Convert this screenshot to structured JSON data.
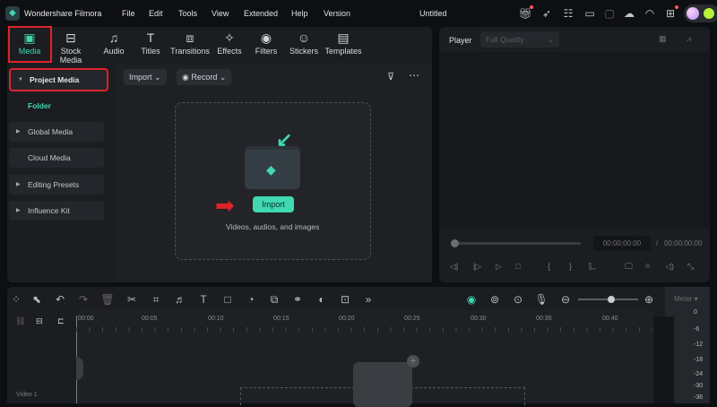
{
  "app": {
    "name": "Wondershare Filmora",
    "project_title": "Untitled"
  },
  "menu": [
    "File",
    "Edit",
    "Tools",
    "View",
    "Extended",
    "Help",
    "Version"
  ],
  "toolbar": [
    {
      "label": "Media",
      "icon": "media-icon",
      "glyph": "▣"
    },
    {
      "label": "Stock Media",
      "icon": "stock-media-icon",
      "glyph": "⊟"
    },
    {
      "label": "Audio",
      "icon": "music-note-icon",
      "glyph": "♫"
    },
    {
      "label": "Titles",
      "icon": "text-t-icon",
      "glyph": "T"
    },
    {
      "label": "Transitions",
      "icon": "transitions-icon",
      "glyph": "⧈"
    },
    {
      "label": "Effects",
      "icon": "effects-star-icon",
      "glyph": "✧"
    },
    {
      "label": "Filters",
      "icon": "filters-icon",
      "glyph": "◉"
    },
    {
      "label": "Stickers",
      "icon": "sticker-icon",
      "glyph": "☺"
    },
    {
      "label": "Templates",
      "icon": "templates-icon",
      "glyph": "▤"
    }
  ],
  "sidebar": {
    "project_media": "Project Media",
    "folder": "Folder",
    "items": [
      "Global Media",
      "Cloud Media",
      "Editing Presets",
      "Influence Kit"
    ]
  },
  "media": {
    "import_dropdown": "Import",
    "record_dropdown": "Record",
    "import_button": "Import",
    "hint": "Videos, audios, and images"
  },
  "player": {
    "label": "Player",
    "quality": "Full Quality",
    "current_time": "00:00:00:00",
    "separator": "/",
    "total_time": "00:00:00:00",
    "progress": 0
  },
  "timeline": {
    "ruler": [
      "00:00",
      "00:05",
      "00:10",
      "00:15",
      "00:20",
      "00:25",
      "00:30",
      "00:35",
      "00:40"
    ],
    "track_label": "Video 1",
    "meter_label": "Meter",
    "meter_scale": [
      "0",
      "-6",
      "-12",
      "-18",
      "-24",
      "-30",
      "-36"
    ],
    "zoom_level": 0.75
  },
  "colors": {
    "accent": "#3fd8b0",
    "highlight": "#e0222a"
  }
}
